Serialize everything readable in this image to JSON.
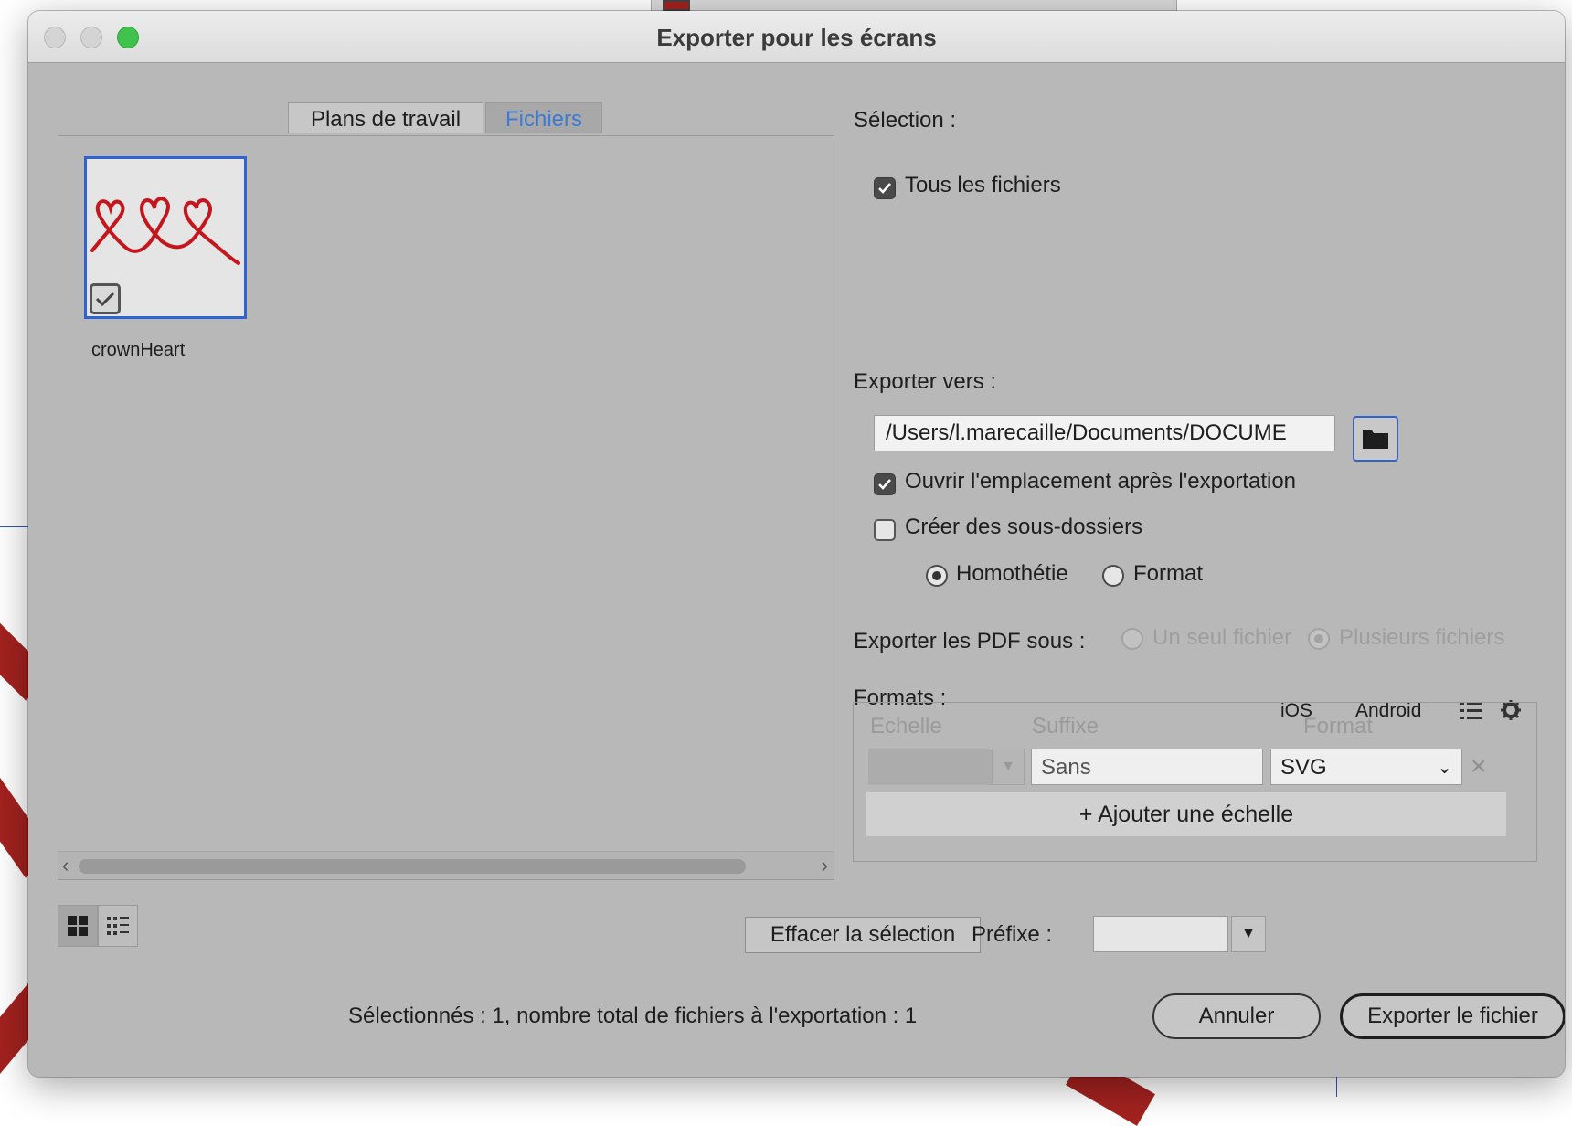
{
  "dialog": {
    "title": "Exporter pour les écrans"
  },
  "tabs": [
    {
      "label": "Plans de travail",
      "active": false
    },
    {
      "label": "Fichiers",
      "active": true
    }
  ],
  "files": [
    {
      "name": "crownHeart",
      "checked": true
    }
  ],
  "selection": {
    "label": "Sélection :",
    "all_files_label": "Tous les fichiers",
    "all_files_checked": true
  },
  "export_to": {
    "label": "Exporter vers :",
    "path": "/Users/l.marecaille/Documents/DOCUME",
    "open_after_label": "Ouvrir l'emplacement après l'exportation",
    "open_after_checked": true,
    "create_subfolders_label": "Créer des sous-dossiers",
    "create_subfolders_checked": false,
    "scale_option_label": "Homothétie",
    "format_option_label": "Format",
    "selected_option": "Homothétie"
  },
  "pdf": {
    "label": "Exporter les PDF sous :",
    "single_label": "Un seul fichier",
    "multiple_label": "Plusieurs fichiers",
    "selected": "Plusieurs fichiers",
    "disabled": true
  },
  "formats": {
    "label": "Formats :",
    "ios_label": "iOS",
    "android_label": "Android",
    "columns": {
      "scale": "Echelle",
      "suffix": "Suffixe",
      "format": "Format"
    },
    "rows": [
      {
        "scale": "",
        "suffix": "Sans",
        "format": "SVG"
      }
    ],
    "add_scale_label": "Ajouter une échelle"
  },
  "bottom": {
    "clear_selection_label": "Effacer la sélection",
    "prefix_label": "Préfixe :",
    "prefix_value": "",
    "status_text": "Sélectionnés : 1, nombre total de fichiers à l'exportation : 1",
    "cancel_label": "Annuler",
    "export_label": "Exporter le fichier"
  },
  "colors": {
    "accent": "#2f62d3",
    "active_tab_text": "#3d7ad6",
    "dialog_bg": "#b8b8b8",
    "artwork_red": "#c4161c"
  }
}
